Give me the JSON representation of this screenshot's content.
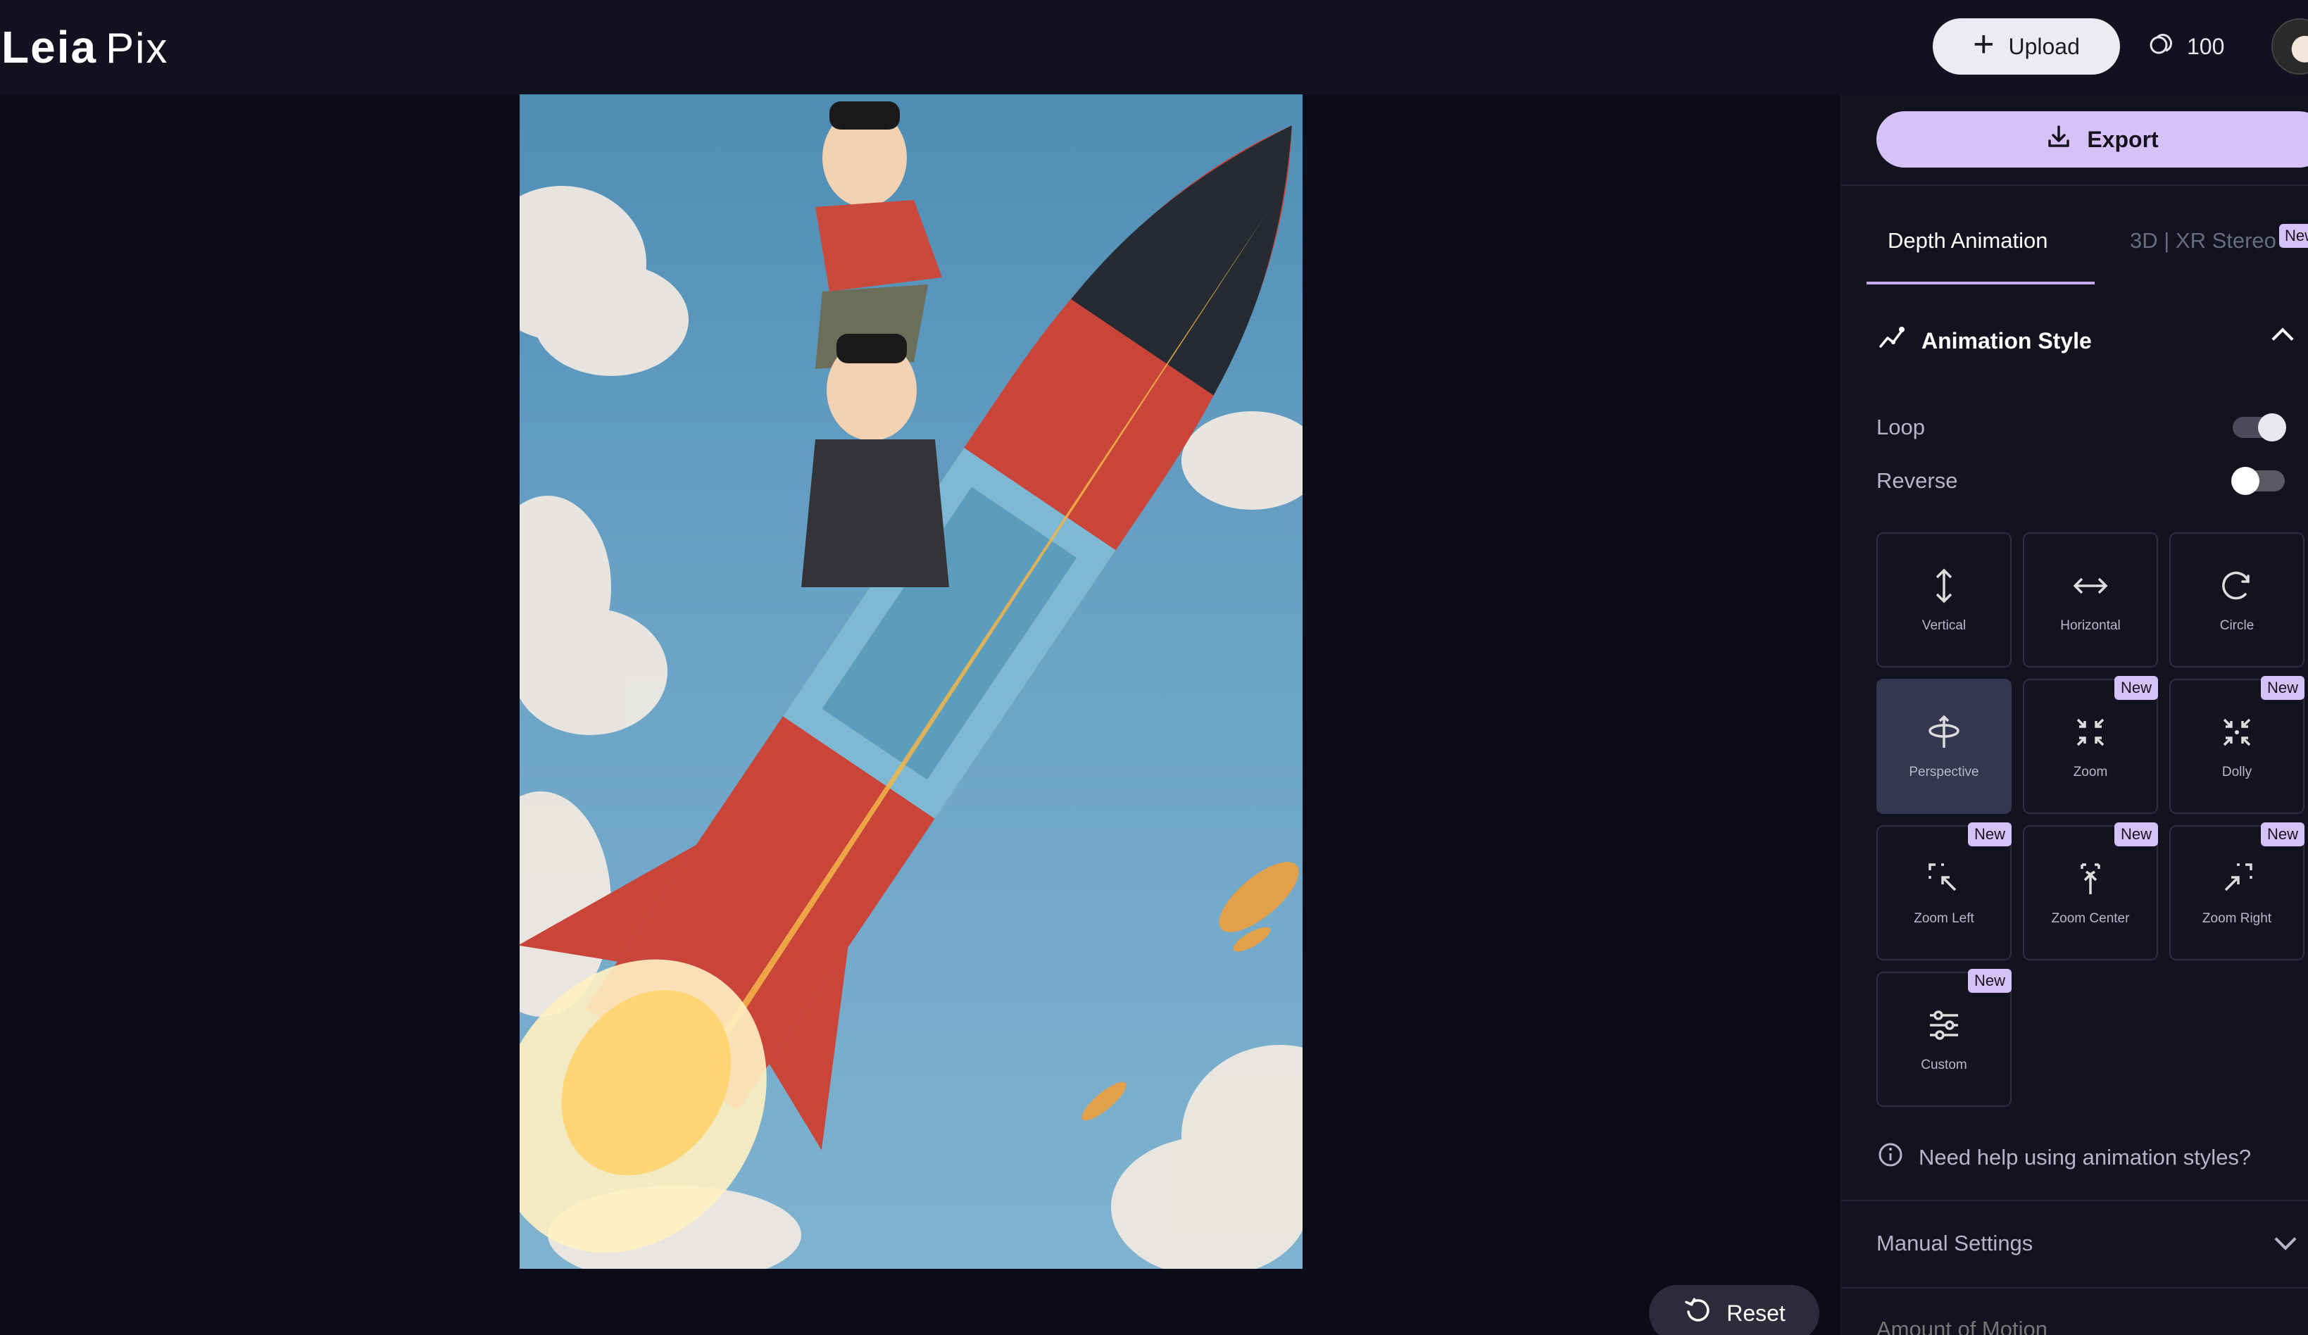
{
  "header": {
    "logo_primary": "Leia",
    "logo_secondary": "Pix",
    "upload_label": "Upload",
    "credits": "100"
  },
  "canvas": {
    "reset_label": "Reset"
  },
  "panel": {
    "export_label": "Export",
    "tabs": [
      {
        "label": "Depth Animation",
        "active": true
      },
      {
        "label": "3D | XR Stereo",
        "active": false,
        "badge": "New"
      }
    ],
    "animation_style": {
      "title": "Animation Style",
      "loop_label": "Loop",
      "loop_on": true,
      "reverse_label": "Reverse",
      "reverse_on": false,
      "styles": [
        {
          "label": "Vertical",
          "icon": "vertical-arrows-icon",
          "badge": ""
        },
        {
          "label": "Horizontal",
          "icon": "horizontal-arrows-icon",
          "badge": ""
        },
        {
          "label": "Circle",
          "icon": "circle-arrow-icon",
          "badge": ""
        },
        {
          "label": "Perspective",
          "icon": "perspective-icon",
          "badge": "",
          "selected": true
        },
        {
          "label": "Zoom",
          "icon": "zoom-icon",
          "badge": "New"
        },
        {
          "label": "Dolly",
          "icon": "dolly-icon",
          "badge": "New"
        },
        {
          "label": "Zoom Left",
          "icon": "zoom-left-icon",
          "badge": "New"
        },
        {
          "label": "Zoom Center",
          "icon": "zoom-center-icon",
          "badge": "New"
        },
        {
          "label": "Zoom Right",
          "icon": "zoom-right-icon",
          "badge": "New"
        },
        {
          "label": "Custom",
          "icon": "sliders-icon",
          "badge": "New"
        }
      ],
      "help_text": "Need help using animation styles?"
    },
    "manual_settings_label": "Manual Settings",
    "next_section_label": "Amount of Motion"
  },
  "colors": {
    "accent": "#d7c2f7",
    "background": "#0c0c18",
    "panel": "#13131f",
    "selected_card": "#363650"
  }
}
